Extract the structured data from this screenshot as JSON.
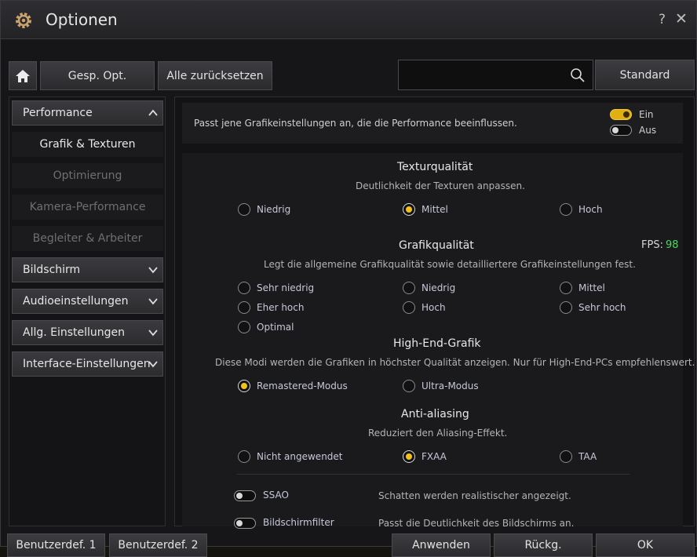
{
  "window": {
    "title": "Optionen",
    "help": "?",
    "close": "✕"
  },
  "toolbar": {
    "gesp": "Gesp. Opt.",
    "reset": "Alle zurücksetzen",
    "search_value": "",
    "standard": "Standard"
  },
  "sidebar": {
    "cat_performance": "Performance",
    "sub_grafik": "Grafik & Texturen",
    "sub_optimierung": "Optimierung",
    "sub_kamera": "Kamera-Performance",
    "sub_begleiter": "Begleiter & Arbeiter",
    "cat_bildschirm": "Bildschirm",
    "cat_audio": "Audioeinstellungen",
    "cat_allg": "Allg. Einstellungen",
    "cat_interface": "Interface-Einstellungen"
  },
  "header": {
    "description": "Passt jene Grafikeinstellungen an, die die Performance beeinflussen.",
    "on": "Ein",
    "off": "Aus",
    "mode": "on"
  },
  "texture": {
    "title": "Texturqualität",
    "desc": "Deutlichkeit der Texturen anpassen.",
    "opt1": "Niedrig",
    "opt2": "Mittel",
    "opt3": "Hoch",
    "selected": "Mittel"
  },
  "graphics": {
    "title": "Grafikqualität",
    "desc": "Legt die allgemeine Grafikqualität sowie detailliertere Grafikeinstellungen fest.",
    "fps_label": "FPS:",
    "fps_value": "98",
    "opt1": "Sehr niedrig",
    "opt2": "Niedrig",
    "opt3": "Mittel",
    "opt4": "Eher hoch",
    "opt5": "Hoch",
    "opt6": "Sehr hoch",
    "opt7": "Optimal",
    "selected": ""
  },
  "highend": {
    "title": "High-End-Grafik",
    "desc": "Diese Modi werden die Grafiken in höchster Qualität anzeigen. Nur für High-End-PCs empfehlenswert.",
    "opt1": "Remastered-Modus",
    "opt2": "Ultra-Modus",
    "selected": "Remastered-Modus"
  },
  "aa": {
    "title": "Anti-aliasing",
    "desc": "Reduziert den Aliasing-Effekt.",
    "opt1": "Nicht angewendet",
    "opt2": "FXAA",
    "opt3": "TAA",
    "selected": "FXAA"
  },
  "ssao": {
    "label": "SSAO",
    "desc": "Schatten werden realistischer angezeigt.",
    "state": "off"
  },
  "filter": {
    "label": "Bildschirmfilter",
    "desc": "Passt die Deutlichkeit des Bildschirms an.",
    "state": "off"
  },
  "footer": {
    "user1": "Benutzerdef. 1",
    "user2": "Benutzerdef. 2",
    "apply": "Anwenden",
    "back": "Rückg.",
    "ok": "OK"
  }
}
